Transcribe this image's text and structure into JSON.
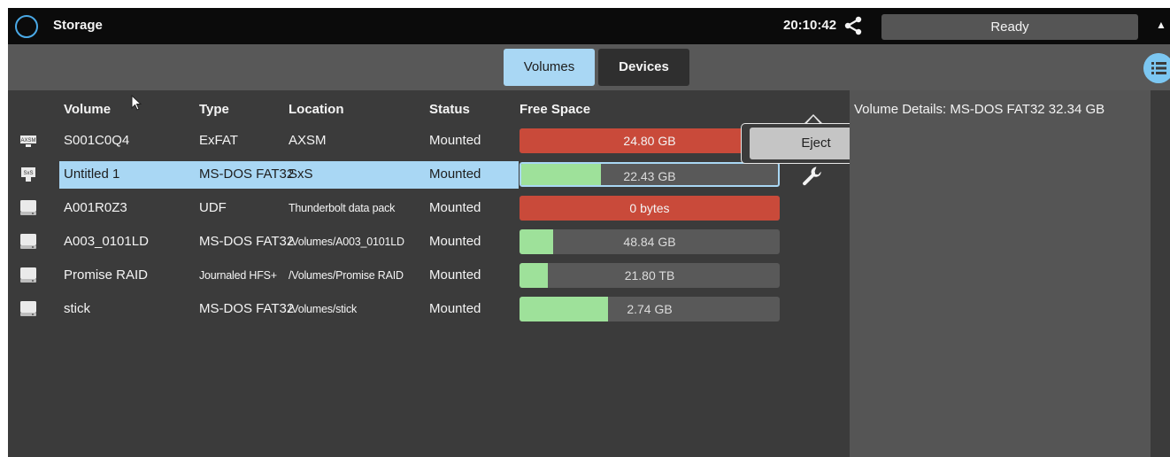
{
  "app": {
    "title": "Storage",
    "clock": "20:10:42",
    "status": "Ready"
  },
  "tabs": {
    "volumes": "Volumes",
    "devices": "Devices",
    "active": "Volumes"
  },
  "table": {
    "headers": {
      "volume": "Volume",
      "type": "Type",
      "location": "Location",
      "status": "Status",
      "free": "Free Space"
    },
    "rows": [
      {
        "icon": "axsm-drive-icon",
        "volume": "S001C0Q4",
        "type": "ExFAT",
        "location": "AXSM",
        "status": "Mounted",
        "free": "24.80 GB",
        "fill_fraction": 0.93,
        "fill_color": "#c94a3a",
        "label_color": "#f4f4f4"
      },
      {
        "icon": "sxs-drive-icon",
        "volume": "Untitled 1",
        "type": "MS-DOS FAT32",
        "location": "SxS",
        "status": "Mounted",
        "free": "22.43 GB",
        "fill_fraction": 0.31,
        "fill_color": "#9ee19a",
        "label_color": "#dcdcdc"
      },
      {
        "icon": "hard-drive-icon",
        "volume": "A001R0Z3",
        "type": "UDF",
        "location": "Thunderbolt data pack",
        "status": "Mounted",
        "free": "0 bytes",
        "fill_fraction": 1.0,
        "fill_color": "#c94a3a",
        "label_color": "#f4f4f4"
      },
      {
        "icon": "hard-drive-icon",
        "volume": "A003_0101LD",
        "type": "MS-DOS FAT32",
        "location": "/Volumes/A003_0101LD",
        "status": "Mounted",
        "free": "48.84 GB",
        "fill_fraction": 0.13,
        "fill_color": "#9ee19a",
        "label_color": "#dcdcdc"
      },
      {
        "icon": "hard-drive-icon",
        "volume": "Promise RAID",
        "type": "Journaled HFS+",
        "location": "/Volumes/Promise RAID",
        "status": "Mounted",
        "free": "21.80 TB",
        "fill_fraction": 0.11,
        "fill_color": "#9ee19a",
        "label_color": "#dcdcdc"
      },
      {
        "icon": "hard-drive-icon",
        "volume": "stick",
        "type": "MS-DOS FAT32",
        "location": "/Volumes/stick",
        "status": "Mounted",
        "free": "2.74 GB",
        "fill_fraction": 0.34,
        "fill_color": "#9ee19a",
        "label_color": "#dcdcdc"
      }
    ],
    "selected_index": 1
  },
  "popup": {
    "eject_label": "Eject"
  },
  "details": {
    "title": "Volume Details: MS-DOS FAT32 32.34 GB"
  },
  "colors": {
    "accent": "#a9d7f4",
    "used_red": "#c94a3a",
    "free_green": "#9ee19a",
    "logo_blue": "#4aa9e6"
  }
}
